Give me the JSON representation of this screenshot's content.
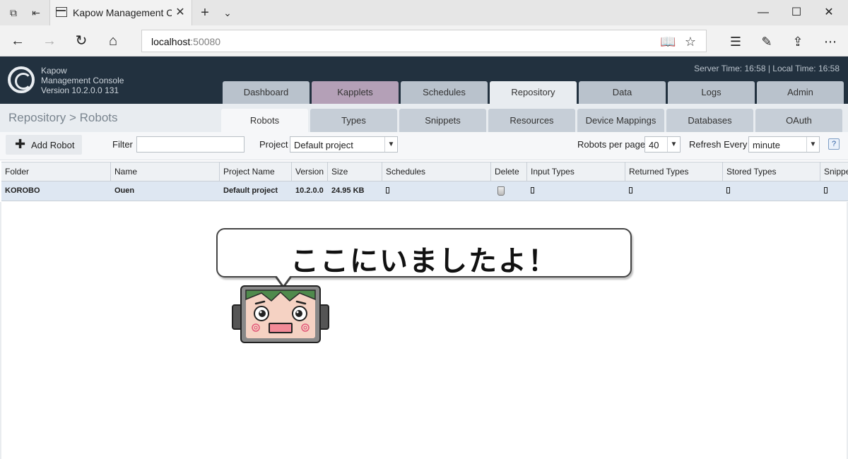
{
  "browser": {
    "tab_title": "Kapow Management Co",
    "url_host": "localhost",
    "url_port": ":50080",
    "icons": [
      "tab-manager-icon",
      "set-aside-icon",
      "page-icon",
      "close-icon",
      "new-tab-icon",
      "chevron-down-icon",
      "minimize-icon",
      "maximize-icon",
      "close-window-icon",
      "back-icon",
      "forward-icon",
      "refresh-icon",
      "home-icon",
      "reading-view-icon",
      "favorite-star-icon",
      "favorites-hub-icon",
      "pen-icon",
      "share-icon",
      "more-icon"
    ]
  },
  "app": {
    "name_line1": "Kapow",
    "name_line2": "Management Console",
    "version": "Version 10.2.0.0 131",
    "server_time": "Server Time: 16:58  |  Local Time: 16:58",
    "main_tabs": [
      "Dashboard",
      "Kapplets",
      "Schedules",
      "Repository",
      "Data",
      "Logs",
      "Admin"
    ],
    "active_main_tab": "Repository",
    "kapplets_color": "#b4a0b7",
    "header_color": "#22313f"
  },
  "repository": {
    "breadcrumb": "Repository > Robots",
    "sub_tabs": [
      "Robots",
      "Types",
      "Snippets",
      "Resources",
      "Device Mappings",
      "Databases",
      "OAuth"
    ],
    "active_sub_tab": "Robots"
  },
  "toolbar": {
    "add_robot_label": "Add Robot",
    "filter_label": "Filter",
    "filter_value": "",
    "project_label": "Project",
    "project_value": "Default project",
    "robots_per_page_label": "Robots per page",
    "robots_per_page_value": "40",
    "refresh_label": "Refresh Every",
    "refresh_value": "minute",
    "help_label": "?"
  },
  "table": {
    "headers": [
      "Folder",
      "Name",
      "Project Name",
      "Version",
      "Size",
      "Schedules",
      "Delete",
      "Input Types",
      "Returned Types",
      "Stored Types",
      "Snippe"
    ],
    "rows": [
      {
        "folder": "KOROBO",
        "name": "Ouen",
        "project": "Default project",
        "version": "10.2.0.0",
        "size": "24.95 KB",
        "schedules": "[]",
        "input_types": "[]",
        "returned_types": "[]",
        "stored_types": "[]",
        "snippets": "[]"
      }
    ]
  },
  "overlay": {
    "speech_text": "ここにいましたよ！"
  }
}
